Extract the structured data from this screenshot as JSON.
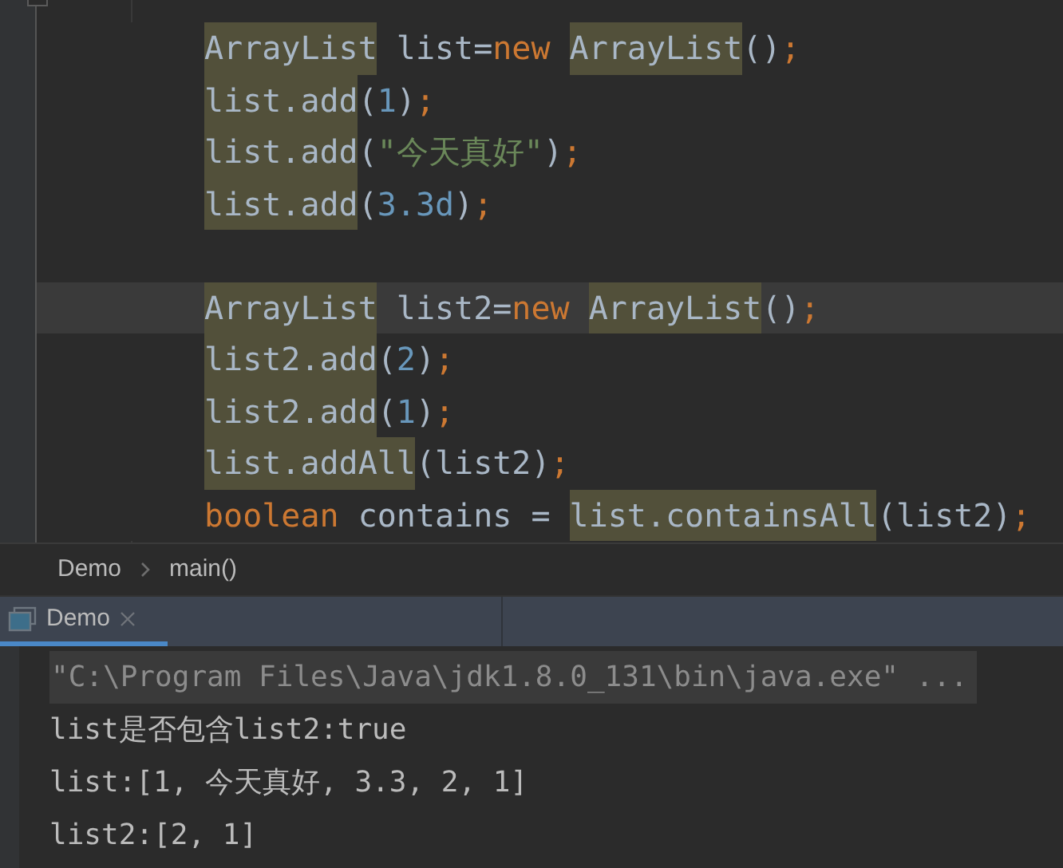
{
  "editor": {
    "lines": [
      {
        "current": false,
        "tokens": [
          {
            "text": "ArrayList",
            "kind": "plain",
            "warning": true
          },
          {
            "text": " list=",
            "kind": "plain",
            "warning": false
          },
          {
            "text": "new ",
            "kind": "keyword",
            "warning": false
          },
          {
            "text": "ArrayList",
            "kind": "plain",
            "warning": true
          },
          {
            "text": "()",
            "kind": "plain",
            "warning": false
          },
          {
            "text": ";",
            "kind": "separator",
            "warning": false
          }
        ]
      },
      {
        "current": false,
        "tokens": [
          {
            "text": "list.add",
            "kind": "plain",
            "warning": true
          },
          {
            "text": "(",
            "kind": "plain",
            "warning": false
          },
          {
            "text": "1",
            "kind": "number",
            "warning": false
          },
          {
            "text": ")",
            "kind": "plain",
            "warning": false
          },
          {
            "text": ";",
            "kind": "separator",
            "warning": false
          }
        ]
      },
      {
        "current": false,
        "tokens": [
          {
            "text": "list.add",
            "kind": "plain",
            "warning": true
          },
          {
            "text": "(",
            "kind": "plain",
            "warning": false
          },
          {
            "text": "\"今天真好\"",
            "kind": "string",
            "warning": false
          },
          {
            "text": ")",
            "kind": "plain",
            "warning": false
          },
          {
            "text": ";",
            "kind": "separator",
            "warning": false
          }
        ]
      },
      {
        "current": false,
        "tokens": [
          {
            "text": "list.add",
            "kind": "plain",
            "warning": true
          },
          {
            "text": "(",
            "kind": "plain",
            "warning": false
          },
          {
            "text": "3.3d",
            "kind": "number",
            "warning": false
          },
          {
            "text": ")",
            "kind": "plain",
            "warning": false
          },
          {
            "text": ";",
            "kind": "separator",
            "warning": false
          }
        ]
      },
      {
        "current": false
      },
      {
        "current": true,
        "tokens": [
          {
            "text": "ArrayList",
            "kind": "plain",
            "warning": true
          },
          {
            "text": " list2=",
            "kind": "plain",
            "warning": false
          },
          {
            "text": "new ",
            "kind": "keyword",
            "warning": false
          },
          {
            "text": "ArrayList",
            "kind": "plain",
            "warning": true
          },
          {
            "text": "()",
            "kind": "plain",
            "warning": false
          },
          {
            "text": ";",
            "kind": "separator",
            "warning": false
          }
        ]
      },
      {
        "current": false,
        "tokens": [
          {
            "text": "list2.add",
            "kind": "plain",
            "warning": true
          },
          {
            "text": "(",
            "kind": "plain",
            "warning": false
          },
          {
            "text": "2",
            "kind": "number",
            "warning": false
          },
          {
            "text": ")",
            "kind": "plain",
            "warning": false
          },
          {
            "text": ";",
            "kind": "separator",
            "warning": false
          }
        ]
      },
      {
        "current": false,
        "tokens": [
          {
            "text": "list2.add",
            "kind": "plain",
            "warning": true
          },
          {
            "text": "(",
            "kind": "plain",
            "warning": false
          },
          {
            "text": "1",
            "kind": "number",
            "warning": false
          },
          {
            "text": ")",
            "kind": "plain",
            "warning": false
          },
          {
            "text": ";",
            "kind": "separator",
            "warning": false
          }
        ]
      },
      {
        "current": false,
        "tokens": [
          {
            "text": "list.addAll",
            "kind": "plain",
            "warning": true
          },
          {
            "text": "(list2)",
            "kind": "plain",
            "warning": false
          },
          {
            "text": ";",
            "kind": "separator",
            "warning": false
          }
        ]
      },
      {
        "current": false,
        "tokens": [
          {
            "text": "boolean",
            "kind": "keyword",
            "warning": false
          },
          {
            "text": " contains = ",
            "kind": "plain",
            "warning": false
          },
          {
            "text": "list.containsAll",
            "kind": "plain",
            "warning": true
          },
          {
            "text": "(list2)",
            "kind": "plain",
            "warning": false
          },
          {
            "text": ";",
            "kind": "separator",
            "warning": false
          }
        ]
      }
    ]
  },
  "breadcrumb": [
    {
      "label": "Demo"
    },
    {
      "label": "main()"
    }
  ],
  "run_panel": {
    "tabs": [
      {
        "label": "Demo",
        "selected": true
      }
    ]
  },
  "console": {
    "command": "\"C:\\Program Files\\Java\\jdk1.8.0_131\\bin\\java.exe\" ...",
    "lines": [
      "list是否包含list2:true",
      "list:[1, 今天真好, 3.3, 2, 1]",
      "list2:[2, 1]"
    ]
  }
}
